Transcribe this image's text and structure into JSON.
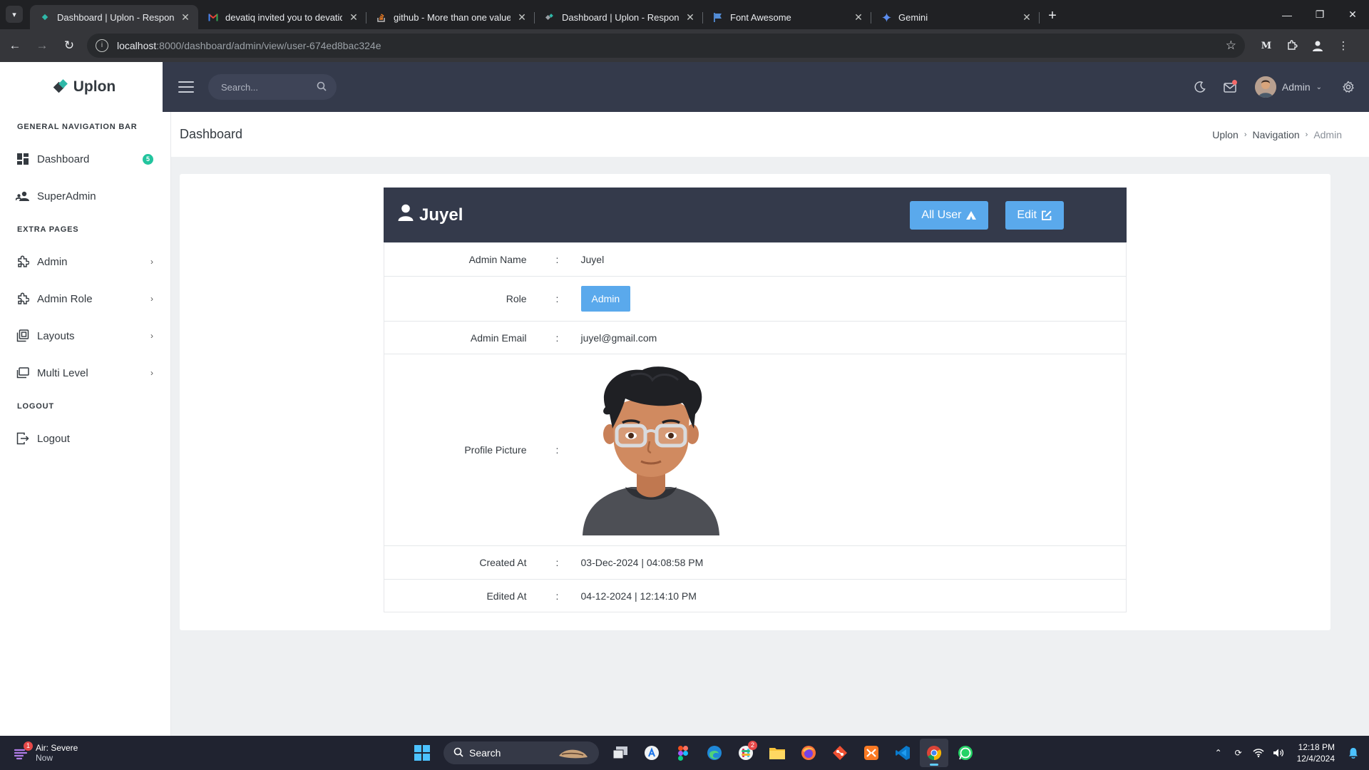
{
  "browser": {
    "tabs": [
      {
        "title": "Dashboard | Uplon - Responsive",
        "icon": "uplon-icon",
        "active": true
      },
      {
        "title": "devatiq invited you to devatiq/",
        "icon": "gmail-icon",
        "active": false
      },
      {
        "title": "github - More than one value fo",
        "icon": "stackoverflow-icon",
        "active": false
      },
      {
        "title": "Dashboard | Uplon - Responsive",
        "icon": "uplon-icon",
        "active": false
      },
      {
        "title": "Font Awesome",
        "icon": "fontawesome-icon",
        "active": false
      },
      {
        "title": "Gemini",
        "icon": "gemini-icon",
        "active": false
      }
    ],
    "url_host": "localhost",
    "url_rest": ":8000/dashboard/admin/view/user-674ed8bac324e",
    "ext_label": "M"
  },
  "sidebar": {
    "brand": "Uplon",
    "sections": {
      "general": "GENERAL NAVIGATION BAR",
      "extra": "EXTRA PAGES",
      "logout": "LOGOUT"
    },
    "items": [
      {
        "label": "Dashboard",
        "badge": "5"
      },
      {
        "label": "SuperAdmin"
      },
      {
        "label": "Admin"
      },
      {
        "label": "Admin Role"
      },
      {
        "label": "Layouts"
      },
      {
        "label": "Multi Level"
      },
      {
        "label": "Logout"
      }
    ]
  },
  "topbar": {
    "search_placeholder": "Search...",
    "user_name": "Admin"
  },
  "page": {
    "title": "Dashboard",
    "breadcrumb": [
      "Uplon",
      "Navigation",
      "Admin"
    ]
  },
  "profile": {
    "name": "Juyel",
    "buttons": {
      "all_user": "All User",
      "edit": "Edit"
    },
    "separator": ":",
    "fields": {
      "admin_name_label": "Admin Name",
      "admin_name": "Juyel",
      "role_label": "Role",
      "role": "Admin",
      "email_label": "Admin Email",
      "email": "juyel@gmail.com",
      "picture_label": "Profile Picture",
      "created_label": "Created At",
      "created": "03-Dec-2024 | 04:08:58 PM",
      "edited_label": "Edited At",
      "edited": "04-12-2024 | 12:14:10 PM"
    }
  },
  "taskbar": {
    "weather_title": "Air: Severe",
    "weather_sub": "Now",
    "weather_badge": "1",
    "search_label": "Search",
    "slack_badge": "2",
    "time": "12:18 PM",
    "date": "12/4/2024"
  },
  "colors": {
    "topbar": "#343a4b",
    "accent_button": "#5aa9ec",
    "badge_green": "#22c49e"
  }
}
